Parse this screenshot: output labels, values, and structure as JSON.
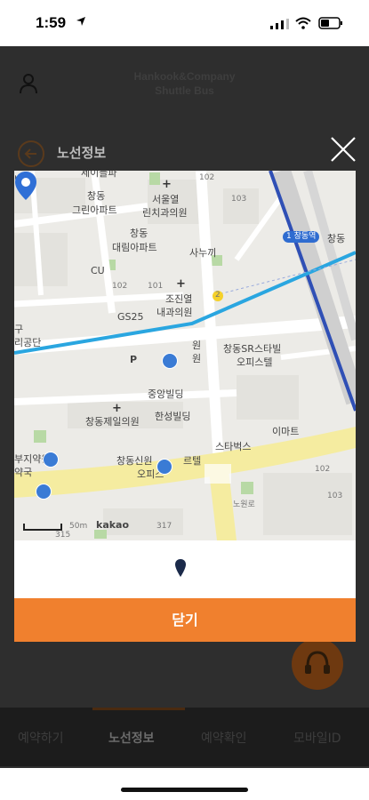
{
  "status_bar": {
    "time": "1:59"
  },
  "header": {
    "brand_line1": "Hankook&Company",
    "brand_line2": "Shuttle Bus",
    "route_title": "노선정보"
  },
  "tabs": [
    {
      "label": "예약하기"
    },
    {
      "label": "노선정보"
    },
    {
      "label": "예약확인"
    },
    {
      "label": "모바일ID"
    }
  ],
  "modal": {
    "close_label": "닫기",
    "map_labels": {
      "top1": "세이블파",
      "l1": "창동",
      "l2": "그린아파트",
      "l3": "서울열",
      "l4": "린치과의원",
      "l5": "창동",
      "l6": "대림아파트",
      "l7": "사누끼",
      "l8": "CU",
      "l9": "102",
      "l10": "101",
      "l11": "조진열",
      "l12": "내과의원",
      "l13": "GS25",
      "l14": "구",
      "l15": "리공단",
      "l16": "P",
      "l17": "창동SR스타빌",
      "l18": "오피스텔",
      "l19": "중앙빌딩",
      "l20": "창동제일의원",
      "l21": "한성빌딩",
      "l22": "이마트",
      "l23": "스타벅스",
      "l24": "부지약원",
      "l25": "창동신원",
      "l26": "르텔",
      "l27": "오피스",
      "l28": "50m",
      "l29": "kakao",
      "l30": "315",
      "l31": "317",
      "l32": "1 창동역",
      "l33": "창동",
      "l34": "빌딩",
      "l35": "102",
      "l36": "103",
      "l37": "2",
      "l38": "원",
      "l39": "약국",
      "l40": "102",
      "l41": "103",
      "l42": "노원로",
      "l43": "창동",
      "l44": "원"
    }
  },
  "colors": {
    "accent": "#f0802e",
    "subway_line1": "#2f4fb5",
    "subway_line4": "#2aa6e0",
    "road_yellow": "#f5eca0"
  }
}
